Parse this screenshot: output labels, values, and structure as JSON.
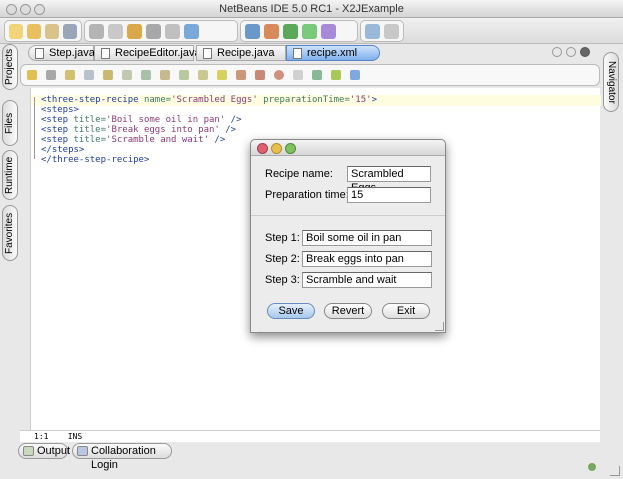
{
  "window": {
    "title": "NetBeans IDE 5.0 RC1 - X2JExample"
  },
  "tabs": [
    {
      "label": "Step.java"
    },
    {
      "label": "RecipeEditor.java"
    },
    {
      "label": "Recipe.java"
    },
    {
      "label": "recipe.xml",
      "active": true
    }
  ],
  "side_tabs": {
    "left": [
      "Projects",
      "Files",
      "Runtime",
      "Favorites"
    ],
    "right": [
      "Navigator"
    ]
  },
  "editor": {
    "lines": [
      {
        "tag": "<three-step-recipe",
        "attrs": " name=",
        "val1": "'Scrambled Eggs'",
        "attrs2": " preparationTime=",
        "val2": "'15'",
        "end": ">"
      },
      {
        "tag": "<steps>"
      },
      {
        "tag": "<step",
        "attrs": " title=",
        "val1": "'Boil some oil in pan'",
        "end": " />"
      },
      {
        "tag": "<step",
        "attrs": " title=",
        "val1": "'Break eggs into pan'",
        "end": " />"
      },
      {
        "tag": "<step",
        "attrs": " title=",
        "val1": "'Scramble and wait'",
        "end": " />"
      },
      {
        "tag": "</steps>"
      },
      {
        "tag": "</three-step-recipe>"
      }
    ],
    "position": "1:1",
    "mode": "INS"
  },
  "bottom_tabs": [
    "Output",
    "Collaboration Login"
  ],
  "dialog": {
    "recipe_name_label": "Recipe name:",
    "recipe_name": "Scrambled Eggs",
    "prep_time_label": "Preparation time:",
    "prep_time": "15",
    "steps": [
      {
        "label": "Step 1:",
        "value": "Boil some oil in pan"
      },
      {
        "label": "Step 2:",
        "value": "Break eggs into pan"
      },
      {
        "label": "Step 3:",
        "value": "Scramble and wait"
      }
    ],
    "save": "Save",
    "revert": "Revert",
    "exit": "Exit"
  }
}
